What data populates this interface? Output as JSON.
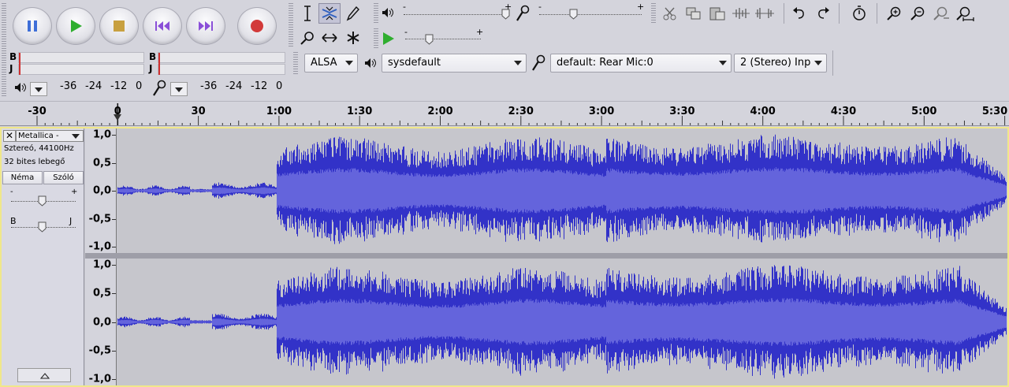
{
  "transport": {
    "pause": "pause-button",
    "play": "play-button",
    "stop": "stop-button",
    "skip_start": "skip-to-start-button",
    "skip_end": "skip-to-end-button",
    "record": "record-button"
  },
  "meters": {
    "left_label": "B",
    "right_label": "J",
    "playback_scale": [
      "-36",
      "-24",
      "-12",
      "0"
    ],
    "record_scale": [
      "-36",
      "-24",
      "-12",
      "0"
    ]
  },
  "mixer": {
    "playback_minus": "-",
    "playback_plus": "+",
    "record_minus": "-",
    "record_plus": "+",
    "speed_minus": "-",
    "speed_plus": "+"
  },
  "devices": {
    "host": "ALSA",
    "playback": "sysdefault",
    "recording": "default: Rear Mic:0",
    "channels": "2 (Stereo) Inp"
  },
  "ruler": {
    "ticks": [
      "-30",
      "0",
      "30",
      "1:00",
      "1:30",
      "2:00",
      "2:30",
      "3:00",
      "3:30",
      "4:00",
      "4:30",
      "5:00",
      "5:30"
    ]
  },
  "track": {
    "name": "Metallica -",
    "info1": "Sztereó, 44100Hz",
    "info2": "32 bites lebegő",
    "mute": "Néma",
    "solo": "Szóló",
    "gain_minus": "-",
    "gain_plus": "+",
    "pan_left": "B",
    "pan_right": "J",
    "scale": [
      "1,0",
      "0,5",
      "0,0",
      "-0,5",
      "-1,0"
    ]
  },
  "colors": {
    "wave_dark": "#3232c8",
    "wave_light": "#6464dc",
    "selection_border": "#f0e78a",
    "meter_red": "#d03030"
  }
}
